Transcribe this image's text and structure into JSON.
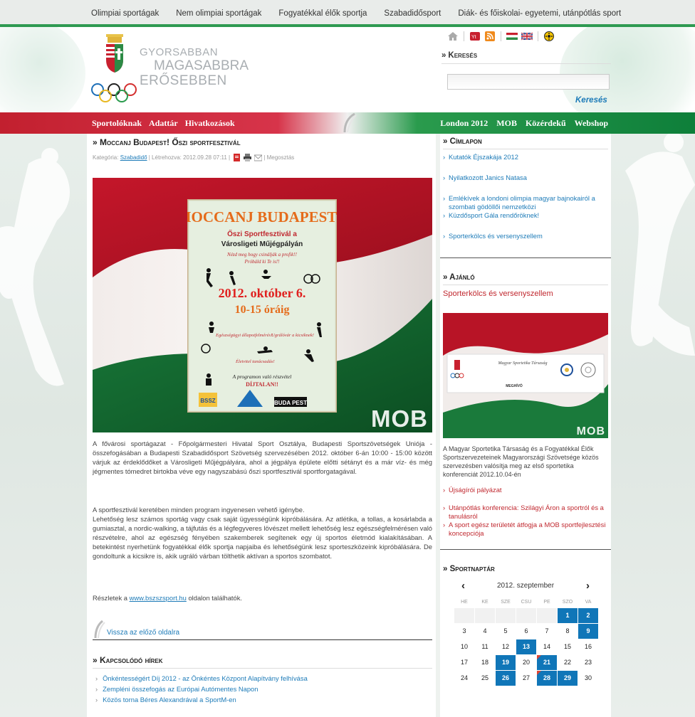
{
  "topnav": {
    "items": [
      "Olimpiai sportágak",
      "Nem olimpiai sportágak",
      "Fogyatékkal élők sportja",
      "Szabadidősport",
      "Diák- és főiskolai- egyetemi, utánpótlás sport"
    ]
  },
  "header": {
    "slogan_1": "GYORSABBAN",
    "slogan_2": "MAGASABBRA",
    "slogan_3": "ERŐSEBBEN",
    "search_title": "Keresés",
    "search_button": "Keresés",
    "search_value": ""
  },
  "mainbar": {
    "left_links": [
      "Sportolóknak",
      "Adattár",
      "Hivatkozások"
    ],
    "right_links": [
      "London 2012",
      "MOB",
      "Közérdekű",
      "Webshop"
    ]
  },
  "article": {
    "title": "Moccanj Budapest! Őszi sportfesztivál",
    "meta_category_label": "Kategória:",
    "meta_category": "Szabadidő",
    "meta_created": "Létrehozva: 2012.09.28 07:11",
    "meta_share": "Megosztás",
    "image_watermark": "MOB",
    "poster_title": "MOCCANJ BUDAPEST!!",
    "poster_line1": "Őszi Sportfesztivál a",
    "poster_line2": "Városligeti Műjégpályán",
    "poster_line3": "Nézd meg hogy csinálják a profik!!",
    "poster_line4": "Próbáld ki Te is!!",
    "poster_date": "2012. október 6.",
    "poster_time": "10-15 óráig",
    "poster_free1": "A programon való részvétel",
    "poster_free2": "DÍJTALAN!!",
    "para1": "A fővárosi sportágazat - Főpolgármesteri Hivatal Sport Osztálya, Budapesti Sportszövetségek Uniója - összefogásában a Budapesti Szabadidősport Szövetség szervezésében 2012. október 6-án 10:00 - 15:00 között várjuk az érdeklődőket a Városligeti Műjégpályára, ahol a jégpálya épülete előtti sétányt és a már víz- és még jégmentes tómedret birtokba véve egy nagyszabású őszi sportfesztivál sportforgatagával.",
    "para2": "A sportfesztivál keretében minden program ingyenesen vehető igénybe.",
    "para3": "Lehetőség lesz számos sportág vagy csak saját ügyességünk kipróbálására. Az atlétika, a tollas, a kosárlabda a gumiasztal, a nordic-walking, a tájfutás és a légfegyveres lövészet mellett lehetőség lesz egészségfelmérésen való részvételre, ahol az egészség fényében szakemberek segítenek egy új sportos életmód kialakításában. A betekintést nyerhetünk fogyatékkal élők sportja napjaiba és lehetőségünk lesz sporteszközeink kipróbálására. De gondoltunk a kicsikre is, akik ugráló várban tölthetik aktívan a sportos szombatot.",
    "para4_prefix": "Részletek a",
    "para4_link": "www.bszszsport.hu",
    "para4_suffix": "oldalon találhatók.",
    "back_link": "Vissza az előző oldalra"
  },
  "related": {
    "title": "Kapcsolódó hírek",
    "items": [
      "Önkéntességért Díj 2012 - az Önkéntes Központ Alapítvány felhívása",
      "Zempléni összefogás az Európai Autómentes Napon",
      "Közös torna Béres Alexandrával a SportM-en"
    ]
  },
  "sidebar": {
    "cimlapon_title": "Címlapon",
    "cimlapon_items": [
      "Kutatók Éjszakája 2012",
      "Nyilatkozott Janics Natasa",
      "Emlékívek a londoni olimpia magyar bajnokairól a szombati gödöllői nemzetközi",
      "Küzdősport Gála rendőröknek!",
      "Sporterkölcs és versenyszellem"
    ],
    "ajanlo_title": "Ajánló",
    "ajanlo_subtitle": "Sporterkölcs és versenyszellem",
    "ajanlo_img_org": "Magyar Sportetika Társaság",
    "ajanlo_img_label": "MEGHÍVÓ",
    "ajanlo_watermark": "MOB",
    "ajanlo_text": "A Magyar Sportetika Társaság és a Fogyatékkal Élők Sportszervezeteinek Magyarországi Szövetsége közös szervezésben valósítja meg az első sportetika konferenciát 2012.10.04-én",
    "ajanlo_items": [
      "Újságírói pályázat",
      "Utánpótlás konferencia: Szilágyi Áron a sportról és a tanulásról",
      "A sport egész területét átfogja a MOB sportfejlesztési koncepciója"
    ],
    "calendar_title": "Sportnaptár",
    "calendar_month": "2012. szeptember",
    "calendar_prev": "‹",
    "calendar_next": "›",
    "calendar_dow": [
      "HE",
      "KE",
      "SZE",
      "CSU",
      "PE",
      "SZO",
      "VA"
    ]
  },
  "calendar_days": [
    {
      "d": "",
      "s": "empty"
    },
    {
      "d": "",
      "s": "empty"
    },
    {
      "d": "",
      "s": "empty"
    },
    {
      "d": "",
      "s": "empty"
    },
    {
      "d": "",
      "s": "empty"
    },
    {
      "d": "1",
      "s": "ev"
    },
    {
      "d": "2",
      "s": "ev"
    },
    {
      "d": "3",
      "s": "white"
    },
    {
      "d": "4",
      "s": "white"
    },
    {
      "d": "5",
      "s": "white"
    },
    {
      "d": "6",
      "s": "white"
    },
    {
      "d": "7",
      "s": "white"
    },
    {
      "d": "8",
      "s": "white"
    },
    {
      "d": "9",
      "s": "ev"
    },
    {
      "d": "10",
      "s": "white"
    },
    {
      "d": "11",
      "s": "white"
    },
    {
      "d": "12",
      "s": "white"
    },
    {
      "d": "13",
      "s": "ev"
    },
    {
      "d": "14",
      "s": "white"
    },
    {
      "d": "15",
      "s": "white"
    },
    {
      "d": "16",
      "s": "white"
    },
    {
      "d": "17",
      "s": "white"
    },
    {
      "d": "18",
      "s": "white"
    },
    {
      "d": "19",
      "s": "ev"
    },
    {
      "d": "20",
      "s": "white"
    },
    {
      "d": "21",
      "s": "ev2"
    },
    {
      "d": "22",
      "s": "white"
    },
    {
      "d": "23",
      "s": "white"
    },
    {
      "d": "24",
      "s": "white"
    },
    {
      "d": "25",
      "s": "white"
    },
    {
      "d": "26",
      "s": "ev"
    },
    {
      "d": "27",
      "s": "white"
    },
    {
      "d": "28",
      "s": "ev2"
    },
    {
      "d": "29",
      "s": "ev"
    },
    {
      "d": "30",
      "s": "white"
    }
  ],
  "colors": {
    "accent_blue": "#1d7bb8",
    "accent_red": "#c0282f",
    "accent_green": "#2f9a52"
  },
  "icons": [
    "home-icon",
    "youtube-icon",
    "rss-icon",
    "hungarian-flag-icon",
    "uk-flag-icon",
    "accessibility-icon",
    "pdf-icon",
    "print-icon",
    "email-icon"
  ]
}
